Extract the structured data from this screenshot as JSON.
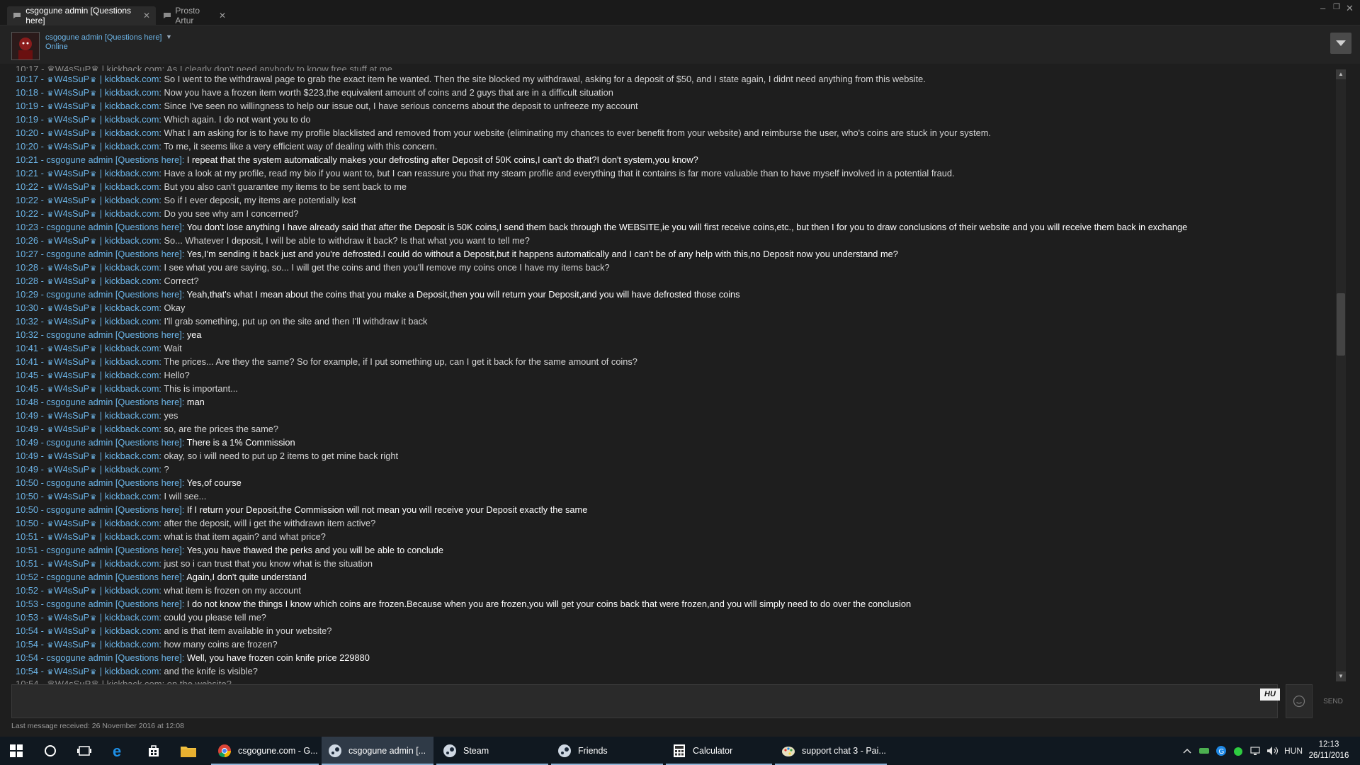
{
  "tabs": [
    {
      "label": "csgogune admin [Questions here]",
      "active": true
    },
    {
      "label": "Prosto Artur",
      "active": false
    }
  ],
  "header": {
    "name": "csgogune admin [Questions here]",
    "status": "Online"
  },
  "chat": {
    "cut_top": "10:17 - ♛W4sSuP♛ | kickback.com: As I clearly don't need anybody to know free stuff at me",
    "cut_bottom": "10:54 - ♛W4sSuP♛ | kickback.com: on the website?",
    "messages": [
      {
        "time": "10:17",
        "admin": false,
        "text": "So I went to the withdrawal page to grab the exact item he wanted. Then the site blocked my withdrawal, asking for a deposit of $50, and I state again, I didnt need anything from this website."
      },
      {
        "time": "10:18",
        "admin": false,
        "text": "Now you have a frozen item worth $223,the equivalent amount of coins and 2 guys that are in a difficult situation"
      },
      {
        "time": "10:19",
        "admin": false,
        "text": "Since I've seen no willingness to help our issue out, I have serious concerns about the deposit to unfreeze my account"
      },
      {
        "time": "10:19",
        "admin": false,
        "text": "Which again. I do not want you to do"
      },
      {
        "time": "10:20",
        "admin": false,
        "text": "What I am asking for is to have my profile blacklisted and removed from your website (eliminating my chances to ever benefit from your website) and reimburse the user, who's coins are stuck in your system."
      },
      {
        "time": "10:20",
        "admin": false,
        "text": "To me, it seems like a very efficient way of dealing with this concern."
      },
      {
        "time": "10:21",
        "admin": true,
        "text": "I repeat that the system automatically makes your defrosting after Deposit of 50K coins,I can't do that?I don't system,you know?"
      },
      {
        "time": "10:21",
        "admin": false,
        "text": "Have a look at my profile, read my bio if you want to, but I can reassure you that my steam profile and everything that it contains is far more valuable than to have myself involved in a potential fraud."
      },
      {
        "time": "10:22",
        "admin": false,
        "text": "But you also can't guarantee my items to be sent back to me"
      },
      {
        "time": "10:22",
        "admin": false,
        "text": "So if I ever deposit, my items are potentially lost"
      },
      {
        "time": "10:22",
        "admin": false,
        "text": "Do you see why am I concerned?"
      },
      {
        "time": "10:23",
        "admin": true,
        "text": "You don't lose anything I have already said that after the Deposit is 50K coins,I send them back through the WEBSITE,ie you will first receive coins,etc., but then I for you to draw conclusions of their website and you will receive them back in exchange"
      },
      {
        "time": "10:26",
        "admin": false,
        "text": "So... Whatever I deposit, I will be able to withdraw it back? Is that what you want to tell me?"
      },
      {
        "time": "10:27",
        "admin": true,
        "text": "Yes,I'm sending it back just and you're defrosted.I could do without a Deposit,but it happens automatically and I can't be of any help with this,no Deposit now you understand me?"
      },
      {
        "time": "10:28",
        "admin": false,
        "text": "I see what you are saying, so... I will get the coins and then you'll remove my coins once I have my items back?"
      },
      {
        "time": "10:28",
        "admin": false,
        "text": "Correct?"
      },
      {
        "time": "10:29",
        "admin": true,
        "text": "Yeah,that's what I mean about the coins that you make a Deposit,then you will return your Deposit,and you will have defrosted those coins"
      },
      {
        "time": "10:30",
        "admin": false,
        "text": "Okay"
      },
      {
        "time": "10:32",
        "admin": false,
        "text": "I'll grab something, put up on the site and then I'll withdraw it back"
      },
      {
        "time": "10:32",
        "admin": true,
        "text": "yea"
      },
      {
        "time": "10:41",
        "admin": false,
        "text": "Wait"
      },
      {
        "time": "10:41",
        "admin": false,
        "text": "The prices... Are they the same? So for example, if I put something up, can I get it back for the same amount of coins?"
      },
      {
        "time": "10:45",
        "admin": false,
        "text": "Hello?"
      },
      {
        "time": "10:45",
        "admin": false,
        "text": "This is important..."
      },
      {
        "time": "10:48",
        "admin": true,
        "text": "man"
      },
      {
        "time": "10:49",
        "admin": false,
        "text": "yes"
      },
      {
        "time": "10:49",
        "admin": false,
        "text": "so, are the prices the same?"
      },
      {
        "time": "10:49",
        "admin": true,
        "text": "There is a 1% Commission"
      },
      {
        "time": "10:49",
        "admin": false,
        "text": "okay, so i will need to put up 2 items to get mine back right"
      },
      {
        "time": "10:49",
        "admin": false,
        "text": "?"
      },
      {
        "time": "10:50",
        "admin": true,
        "text": "Yes,of course"
      },
      {
        "time": "10:50",
        "admin": false,
        "text": "I will see..."
      },
      {
        "time": "10:50",
        "admin": true,
        "text": "If I return your Deposit,the Commission will not mean you will receive your Deposit exactly the same"
      },
      {
        "time": "10:50",
        "admin": false,
        "text": "after the deposit, will i get the withdrawn item active?"
      },
      {
        "time": "10:51",
        "admin": false,
        "text": "what is that item again? and what price?"
      },
      {
        "time": "10:51",
        "admin": true,
        "text": "Yes,you have thawed the perks and you will be able to conclude"
      },
      {
        "time": "10:51",
        "admin": false,
        "text": "just so i can trust that you know what is the situation"
      },
      {
        "time": "10:52",
        "admin": true,
        "text": "Again,I don't quite understand"
      },
      {
        "time": "10:52",
        "admin": false,
        "text": "what item is frozen on my account"
      },
      {
        "time": "10:53",
        "admin": true,
        "text": "I do not know the things I know which coins are frozen.Because when you are frozen,you will get your coins back that were frozen,and you will simply need to do over the conclusion"
      },
      {
        "time": "10:53",
        "admin": false,
        "text": "could you please tell me?"
      },
      {
        "time": "10:54",
        "admin": false,
        "text": "and is that item available in your website?"
      },
      {
        "time": "10:54",
        "admin": false,
        "text": "how many coins are frozen?"
      },
      {
        "time": "10:54",
        "admin": true,
        "text": "Well, you have frozen coin knife price 229880"
      },
      {
        "time": "10:54",
        "admin": false,
        "text": "and the knife is visible?"
      }
    ]
  },
  "senders": {
    "admin": "csgogune admin [Questions here]",
    "user_name": "W4sSuP",
    "user_suffix": " | kickback.com"
  },
  "input": {
    "lang_badge": "HU",
    "send_label": "SEND",
    "last_message": "Last message received: 26 November 2016 at 12:08"
  },
  "taskbar": {
    "apps": [
      {
        "label": "csgogune.com - G...",
        "icon": "chrome-icon"
      },
      {
        "label": "csgogune admin [...",
        "icon": "steam-chat-icon",
        "active": true
      },
      {
        "label": "Steam",
        "icon": "steam-icon"
      },
      {
        "label": "Friends",
        "icon": "steam-friends-icon"
      },
      {
        "label": "Calculator",
        "icon": "calculator-icon"
      },
      {
        "label": "support chat 3 - Pai...",
        "icon": "paint-icon"
      }
    ],
    "language": "HUN",
    "time": "12:13",
    "date": "26/11/2016"
  },
  "colors": {
    "accent": "#6cb5e8",
    "background": "#1e1e1e",
    "taskbar": "#101820"
  }
}
